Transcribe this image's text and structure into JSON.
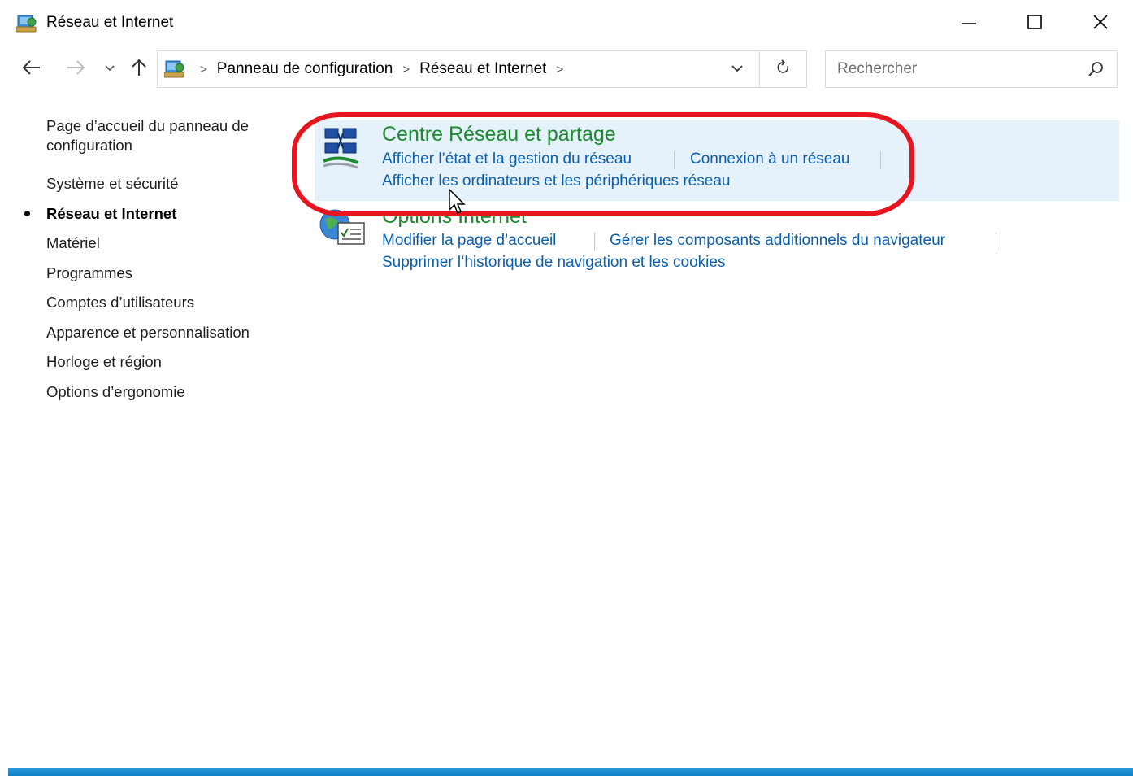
{
  "window": {
    "title": "Réseau et Internet"
  },
  "address": {
    "crumbs": [
      "Panneau de configuration",
      "Réseau et Internet"
    ],
    "separator": ">"
  },
  "search": {
    "placeholder": "Rechercher"
  },
  "sidebar": {
    "items": [
      {
        "label_line1": "Page d’accueil du panneau de",
        "label_line2": "configuration"
      },
      {
        "label": "Système et sécurité"
      },
      {
        "label": "Réseau et Internet",
        "active": true
      },
      {
        "label": "Matériel"
      },
      {
        "label": "Programmes"
      },
      {
        "label": "Comptes d’utilisateurs"
      },
      {
        "label": "Apparence et personnalisation"
      },
      {
        "label": "Horloge et région"
      },
      {
        "label": "Options d’ergonomie"
      }
    ]
  },
  "categories": [
    {
      "title": "Centre Réseau et partage",
      "links": [
        "Afficher l’état et la gestion du réseau",
        "Connexion à un réseau",
        "Afficher les ordinateurs et les périphériques réseau"
      ]
    },
    {
      "title": "Options Internet",
      "links": [
        "Modifier la page d’accueil",
        "Gérer les composants additionnels du navigateur",
        "Supprimer l’historique de navigation et les cookies"
      ]
    }
  ],
  "colors": {
    "category_title": "#1c8a2e",
    "link": "#0b5fb0",
    "highlight": "#e5f1fb",
    "annotation": "#e8141e",
    "taskbar": "#0f7fc7"
  },
  "icons": [
    "network-folder-icon",
    "minimize-icon",
    "maximize-icon",
    "close-icon",
    "back-arrow-icon",
    "forward-arrow-icon",
    "chevron-down-icon",
    "up-arrow-icon",
    "refresh-icon",
    "search-icon",
    "network-sharing-icon",
    "internet-options-icon",
    "mouse-cursor-icon"
  ]
}
